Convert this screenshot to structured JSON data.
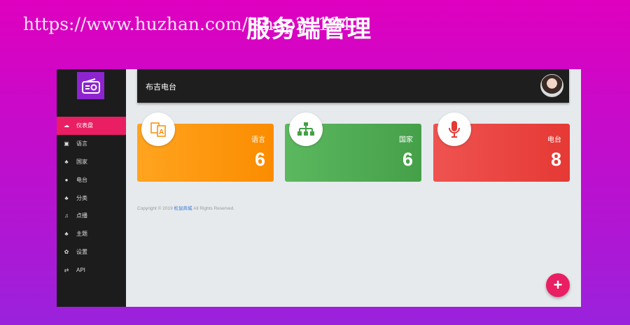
{
  "watermark": {
    "url": "https://www.huzhan.com/ishop21194",
    "title": "服务端管理"
  },
  "header": {
    "title": "布吉电台"
  },
  "sidebar": {
    "items": [
      {
        "label": "仪表盘",
        "icon": "dashboard-icon",
        "glyph": "☁"
      },
      {
        "label": "语言",
        "icon": "translate-icon",
        "glyph": "▣"
      },
      {
        "label": "国家",
        "icon": "sitemap-icon",
        "glyph": "♣"
      },
      {
        "label": "电台",
        "icon": "microphone-icon",
        "glyph": "●"
      },
      {
        "label": "分类",
        "icon": "sitemap-icon",
        "glyph": "♣"
      },
      {
        "label": "点播",
        "icon": "music-icon",
        "glyph": "♫"
      },
      {
        "label": "主题",
        "icon": "sitemap-icon",
        "glyph": "♣"
      },
      {
        "label": "设置",
        "icon": "gear-icon",
        "glyph": "✿"
      },
      {
        "label": "API",
        "icon": "exchange-icon",
        "glyph": "⇄"
      }
    ]
  },
  "cards": [
    {
      "label": "语言",
      "value": "6",
      "color": "#fb8c00"
    },
    {
      "label": "国家",
      "value": "6",
      "color": "#43a047"
    },
    {
      "label": "电台",
      "value": "8",
      "color": "#e53935"
    }
  ],
  "footer": {
    "prefix": "Copyright © 2019 ",
    "link": "松鼠商城",
    "suffix": " All Rights Reserved."
  },
  "fab": {
    "label": "+"
  }
}
